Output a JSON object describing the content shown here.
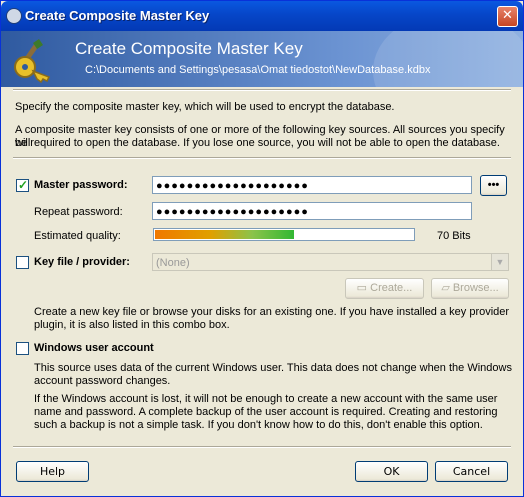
{
  "window": {
    "title": "Create Composite Master Key",
    "close_glyph": "✕"
  },
  "banner": {
    "title": "Create Composite Master Key",
    "path": "C:\\Documents and Settings\\pesasa\\Omat tiedostot\\NewDatabase.kdbx",
    "icon": "key-icon"
  },
  "intro": {
    "line1": "Specify the composite master key, which will be used to encrypt the database.",
    "line2": "A composite master key consists of one or more of the following key sources. All sources you specify will",
    "line3": "be required to open the database.  If you lose one source, you will not be able to open the database."
  },
  "master_password": {
    "label": "Master password:",
    "checked": true,
    "value": "●●●●●●●●●●●●●●●●●●●●",
    "reveal_button": "•••"
  },
  "repeat_password": {
    "label": "Repeat password:",
    "value": "●●●●●●●●●●●●●●●●●●●●"
  },
  "quality": {
    "label": "Estimated quality:",
    "value_text": "70 Bits",
    "fraction": 0.54
  },
  "key_file": {
    "label": "Key file / provider:",
    "checked": false,
    "selected": "(None)",
    "create_button": "Create...",
    "browse_button": "Browse...",
    "help1": "Create a new key file or browse your disks for an existing one. If you have installed a key provider",
    "help2": "plugin, it is also listed in this combo box."
  },
  "windows_account": {
    "label": "Windows user account",
    "checked": false,
    "desc1": "This source uses data of the current Windows user. This data does not change when the Windows",
    "desc2": "account password changes.",
    "warn1": "If the Windows account is lost, it will not be enough to create a new account with the same user",
    "warn2": "name and password. A complete backup of the user account is required. Creating and restoring",
    "warn3": "such a backup is not a simple task. If you don't know how to do this, don't enable this option."
  },
  "footer": {
    "help": "Help",
    "ok": "OK",
    "cancel": "Cancel"
  },
  "colors": {
    "accent": "#0a58e0",
    "check": "#21a121"
  }
}
